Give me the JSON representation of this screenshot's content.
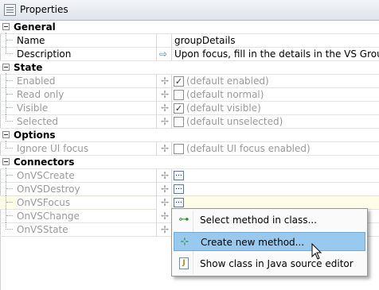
{
  "window": {
    "title": "Properties"
  },
  "categories": {
    "general": "General",
    "state": "State",
    "options": "Options",
    "connectors": "Connectors"
  },
  "general": {
    "name": {
      "label": "Name",
      "value": "groupDetails"
    },
    "description": {
      "label": "Description",
      "value": "Upon focus, fill in the details in the VS Group"
    }
  },
  "state": {
    "enabled": {
      "label": "Enabled",
      "value": "(default enabled)",
      "checked": true
    },
    "read_only": {
      "label": "Read only",
      "value": "(default normal)",
      "checked": false
    },
    "visible": {
      "label": "Visible",
      "value": "(default visible)",
      "checked": true
    },
    "selected": {
      "label": "Selected",
      "value": "(default unselected)",
      "checked": false
    }
  },
  "options": {
    "ignore_ui_focus": {
      "label": "Ignore UI focus",
      "value": "(default UI focus enabled)",
      "checked": false
    }
  },
  "connectors": {
    "on_vs_create": {
      "label": "OnVSCreate",
      "button": "..."
    },
    "on_vs_destroy": {
      "label": "OnVSDestroy",
      "button": "..."
    },
    "on_vs_focus": {
      "label": "OnVSFocus",
      "button": "..."
    },
    "on_vs_change": {
      "label": "OnVSChange"
    },
    "on_vs_state": {
      "label": "OnVSState"
    }
  },
  "context_menu": {
    "select_method": "Select method in class...",
    "create_method": "Create new method...",
    "show_class": "Show class in Java source editor"
  },
  "symbols": {
    "plus": "✢",
    "arrow": "⇨",
    "check": "✓"
  },
  "icons": {
    "select_method": "method-link-icon",
    "create_method": "new-method-icon",
    "show_class": "java-file-icon"
  },
  "colors": {
    "menu_highlight": "#99c9ef",
    "focus_row": "#fffce8",
    "disabled_text": "#9a9a9a"
  }
}
